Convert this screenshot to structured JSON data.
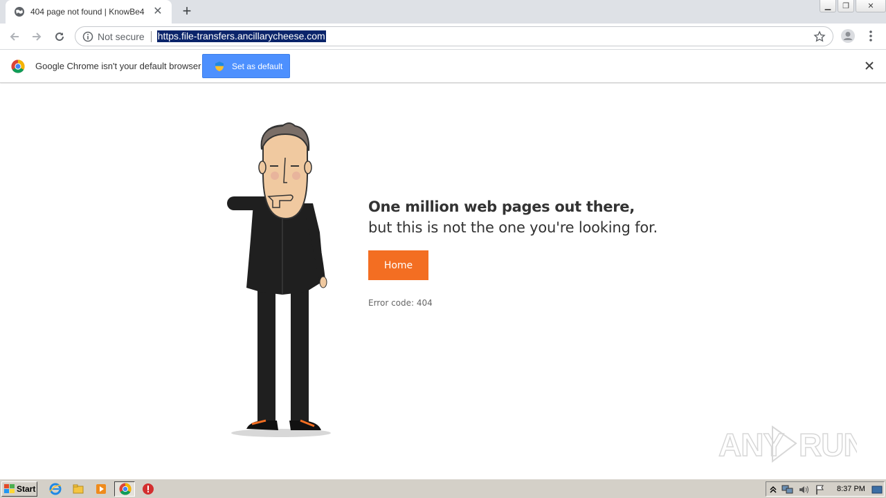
{
  "browser": {
    "tab": {
      "title": "404 page not found | KnowBe4"
    },
    "omnibox": {
      "security_label": "Not secure",
      "url": "https.file-transfers.ancillarycheese.com"
    }
  },
  "infobar": {
    "message": "Google Chrome isn't your default browser",
    "button_label": "Set as default"
  },
  "page": {
    "headline_line1": "One million web pages out there,",
    "headline_line2": "but this is not the one you're looking for.",
    "home_button": "Home",
    "error_code": "Error code: 404"
  },
  "watermark": {
    "text": "ANY RUN"
  },
  "taskbar": {
    "start_label": "Start",
    "clock": "8:37 PM"
  },
  "colors": {
    "accent": "#f36e22",
    "infobar_button": "#4d90fe",
    "url_highlight": "#0a246a"
  }
}
